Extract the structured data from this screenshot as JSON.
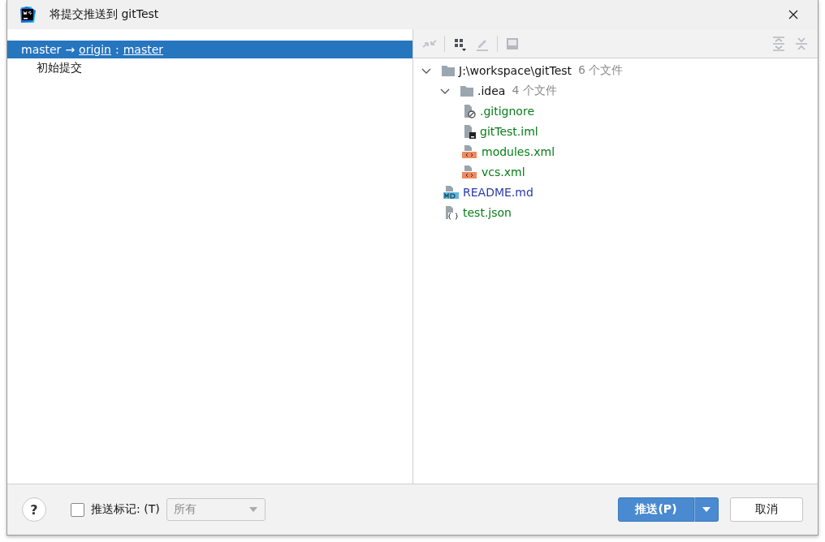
{
  "window": {
    "title": "将提交推送到 gitTest"
  },
  "commits": {
    "branch": {
      "local": "master",
      "arrow": "→",
      "remote": "origin",
      "separator": ":",
      "target": "master",
      "selected": true
    },
    "items": [
      {
        "message": "初始提交",
        "selected": false
      }
    ]
  },
  "tree": [
    {
      "kind": "folder",
      "name": "J:\\workspace\\gitTest",
      "count": "6 个文件",
      "expanded": true,
      "children": [
        {
          "kind": "folder",
          "name": ".idea",
          "count": "4 个文件",
          "expanded": true,
          "children": [
            {
              "kind": "ignore",
              "name": ".gitignore",
              "color": "#067d17"
            },
            {
              "kind": "iml",
              "name": "gitTest.iml",
              "color": "#067d17"
            },
            {
              "kind": "xml",
              "name": "modules.xml",
              "color": "#067d17"
            },
            {
              "kind": "xml",
              "name": "vcs.xml",
              "color": "#067d17"
            }
          ]
        },
        {
          "kind": "md",
          "name": "README.md",
          "color": "#2a3ba8"
        },
        {
          "kind": "json",
          "name": "test.json",
          "color": "#067d17"
        }
      ]
    }
  ],
  "footer": {
    "help": "?",
    "push_tags": {
      "label": "推送标记: (T)",
      "checked": false
    },
    "tags_select": {
      "value": "所有",
      "disabled": true
    },
    "push_button": "推送(P)",
    "cancel_button": "取消"
  }
}
